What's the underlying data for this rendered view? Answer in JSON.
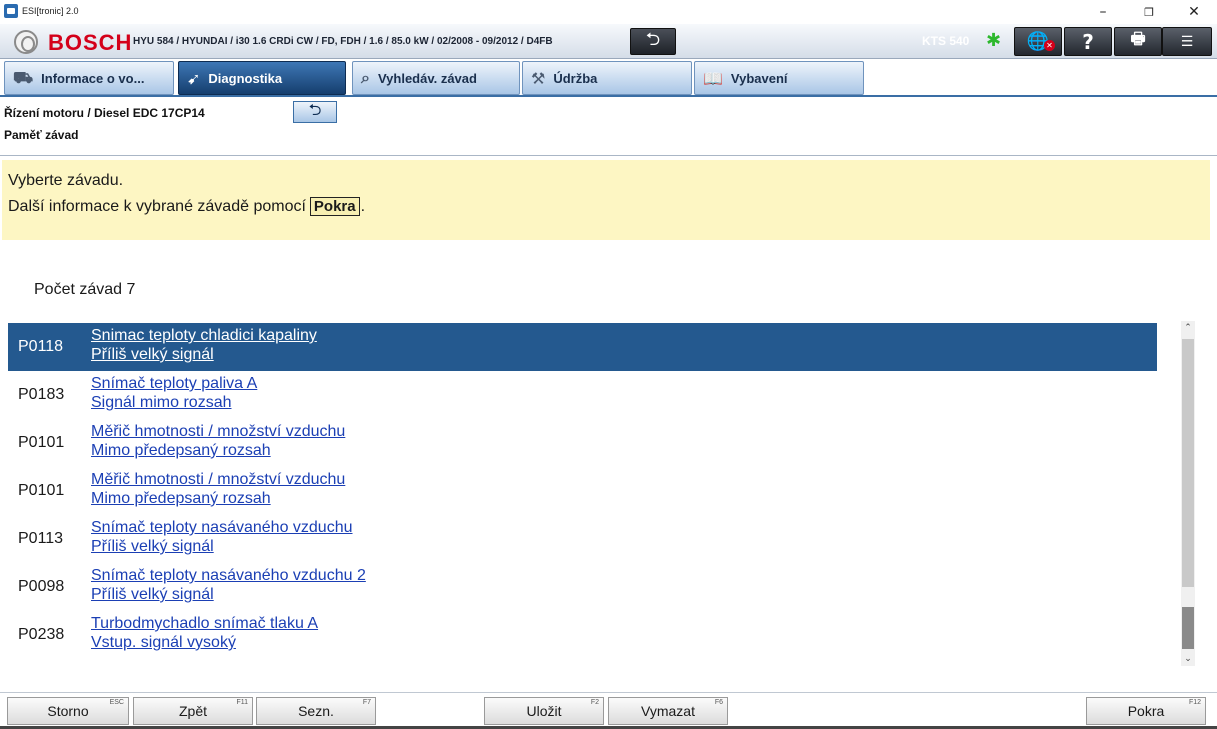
{
  "window": {
    "title": "ESI[tronic] 2.0",
    "minimize": "–",
    "maximize": "❐",
    "close": "✕"
  },
  "header": {
    "brand": "BOSCH",
    "vehicle": "HYU 584 / HYUNDAI / i30 1.6 CRDi CW / FD, FDH / 1.6 / 85.0 kW / 02/2008 - 09/2012 / D4FB",
    "back_icon": "⮌",
    "device": "KTS 540",
    "bluetooth_icon": "✱",
    "globe_icon": "🌐",
    "help_icon": "?",
    "print_icon": "🖶",
    "menu_icon": "☰"
  },
  "tabs": [
    {
      "label": "Informace o vo...",
      "icon": "car-info-icon",
      "glyph": "⛟",
      "active": false
    },
    {
      "label": "Diagnostika",
      "icon": "diagnostics-icon",
      "glyph": "➹",
      "active": true
    },
    {
      "label": "Vyhledáv. závad",
      "icon": "fault-search-icon",
      "glyph": "⌕",
      "active": false
    },
    {
      "label": "Údržba",
      "icon": "maintenance-icon",
      "glyph": "⚒",
      "active": false
    },
    {
      "label": "Vybavení",
      "icon": "equipment-icon",
      "glyph": "📖",
      "active": false
    }
  ],
  "breadcrumb": {
    "line1": "Řízení motoru / Diesel EDC 17CP14",
    "line2": "Paměť závad",
    "back_icon": "⮌"
  },
  "info": {
    "line1": "Vyberte závadu.",
    "line2_prefix": "Další informace k vybrané závadě pomocí",
    "line2_button": "Pokra",
    "line2_suffix": "."
  },
  "fault_count": "Počet závad 7",
  "faults": [
    {
      "code": "P0118",
      "line1": "Snimac teploty chladici kapaliny",
      "line2": "Příliš velký signál",
      "selected": true
    },
    {
      "code": "P0183",
      "line1": "Snímač teploty paliva A",
      "line2": "Signál mimo rozsah",
      "selected": false
    },
    {
      "code": "P0101",
      "line1": "Měřič hmotnosti / množství vzduchu",
      "line2": "Mimo předepsaný rozsah",
      "selected": false
    },
    {
      "code": "P0101",
      "line1": "Měřič hmotnosti / množství vzduchu",
      "line2": "Mimo předepsaný rozsah",
      "selected": false
    },
    {
      "code": "P0113",
      "line1": "Snímač teploty nasávaného vzduchu",
      "line2": "Příliš velký signál",
      "selected": false
    },
    {
      "code": "P0098",
      "line1": "Snímač teploty nasávaného vzduchu 2",
      "line2": "Příliš velký signál",
      "selected": false
    },
    {
      "code": "P0238",
      "line1": "Turbodmychadlo snímač tlaku A",
      "line2": "Vstup. signál vysoký",
      "selected": false
    }
  ],
  "scrollbar": {
    "up": "⌃",
    "down": "⌄"
  },
  "toolbar": {
    "storno": {
      "label": "Storno",
      "key": "ESC"
    },
    "zpet": {
      "label": "Zpět",
      "key": "F11"
    },
    "sezn": {
      "label": "Sezn.",
      "key": "F7"
    },
    "ulozit": {
      "label": "Uložit",
      "key": "F2"
    },
    "vymazat": {
      "label": "Vymazat",
      "key": "F6"
    },
    "pokra": {
      "label": "Pokra",
      "key": "F12"
    }
  }
}
